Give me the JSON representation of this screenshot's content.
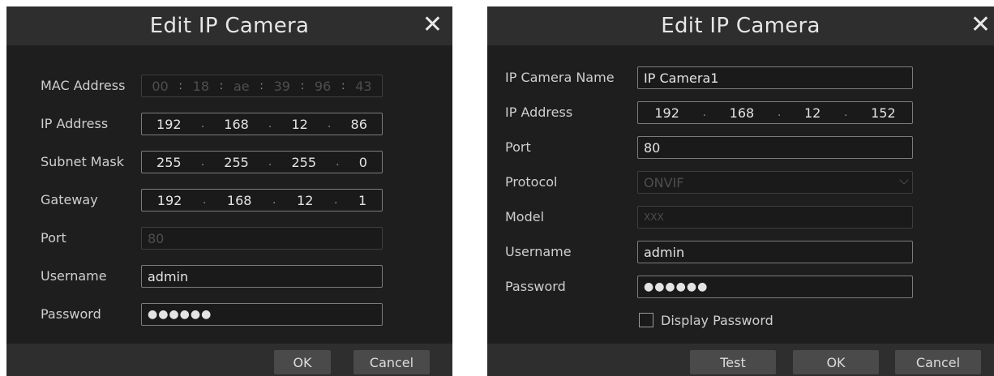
{
  "left_dialog": {
    "title": "Edit IP Camera",
    "close_glyph": "✕",
    "mac_address": {
      "label": "MAC Address",
      "octets": [
        "00",
        "18",
        "ae",
        "39",
        "96",
        "43"
      ],
      "separator": ":"
    },
    "ip_address": {
      "label": "IP Address",
      "octets": [
        "192",
        "168",
        "12",
        "86"
      ],
      "separator": "."
    },
    "subnet_mask": {
      "label": "Subnet Mask",
      "octets": [
        "255",
        "255",
        "255",
        "0"
      ],
      "separator": "."
    },
    "gateway": {
      "label": "Gateway",
      "octets": [
        "192",
        "168",
        "12",
        "1"
      ],
      "separator": "."
    },
    "port": {
      "label": "Port",
      "value": "80"
    },
    "username": {
      "label": "Username",
      "value": "admin"
    },
    "password": {
      "label": "Password",
      "value": "●●●●●●"
    },
    "buttons": {
      "ok": "OK",
      "cancel": "Cancel"
    }
  },
  "right_dialog": {
    "title": "Edit IP Camera",
    "close_glyph": "✕",
    "camera_name": {
      "label": "IP Camera Name",
      "value": "IP Camera1"
    },
    "ip_address": {
      "label": "IP Address",
      "octets": [
        "192",
        "168",
        "12",
        "152"
      ],
      "separator": "."
    },
    "port": {
      "label": "Port",
      "value": "80"
    },
    "protocol": {
      "label": "Protocol",
      "value": "ONVIF"
    },
    "model": {
      "label": "Model",
      "value": "XXX"
    },
    "username": {
      "label": "Username",
      "value": "admin"
    },
    "password": {
      "label": "Password",
      "value": "●●●●●●"
    },
    "display_password": {
      "label": "Display Password",
      "checked": false
    },
    "buttons": {
      "test": "Test",
      "ok": "OK",
      "cancel": "Cancel"
    }
  },
  "colors": {
    "panel_bg": "#1e1e1e",
    "bar_bg": "#2e2e2e",
    "field_border": "#7c7c7c",
    "button_bg": "#4a4a4a",
    "disabled_text": "#4e4e4e"
  }
}
